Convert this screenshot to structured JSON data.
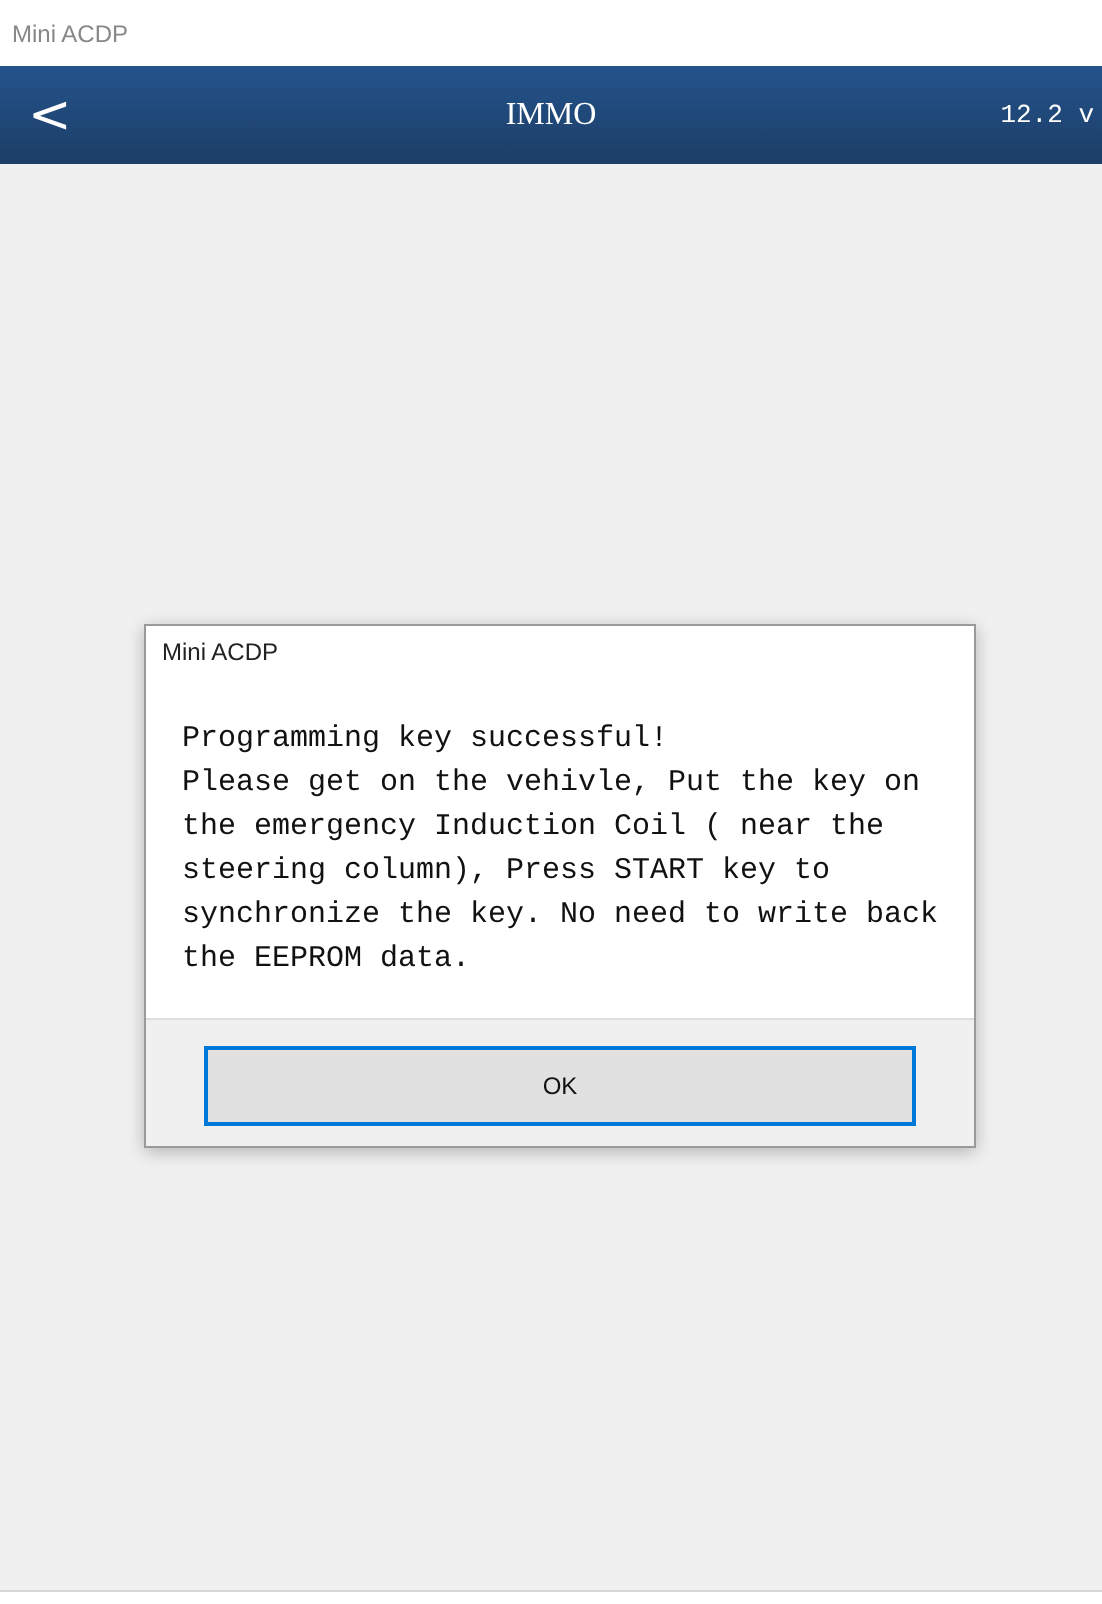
{
  "window": {
    "title": "Mini ACDP"
  },
  "header": {
    "back": "<",
    "title": "IMMO",
    "voltage": "12.2 v"
  },
  "dialog": {
    "title": "Mini ACDP",
    "heading": "Programming key successful!",
    "message": "Please get on the vehivle, Put the key on the emergency Induction Coil ( near the steering column), Press START key to synchronize the key. No need to write back the EEPROM data.",
    "button": "OK"
  }
}
